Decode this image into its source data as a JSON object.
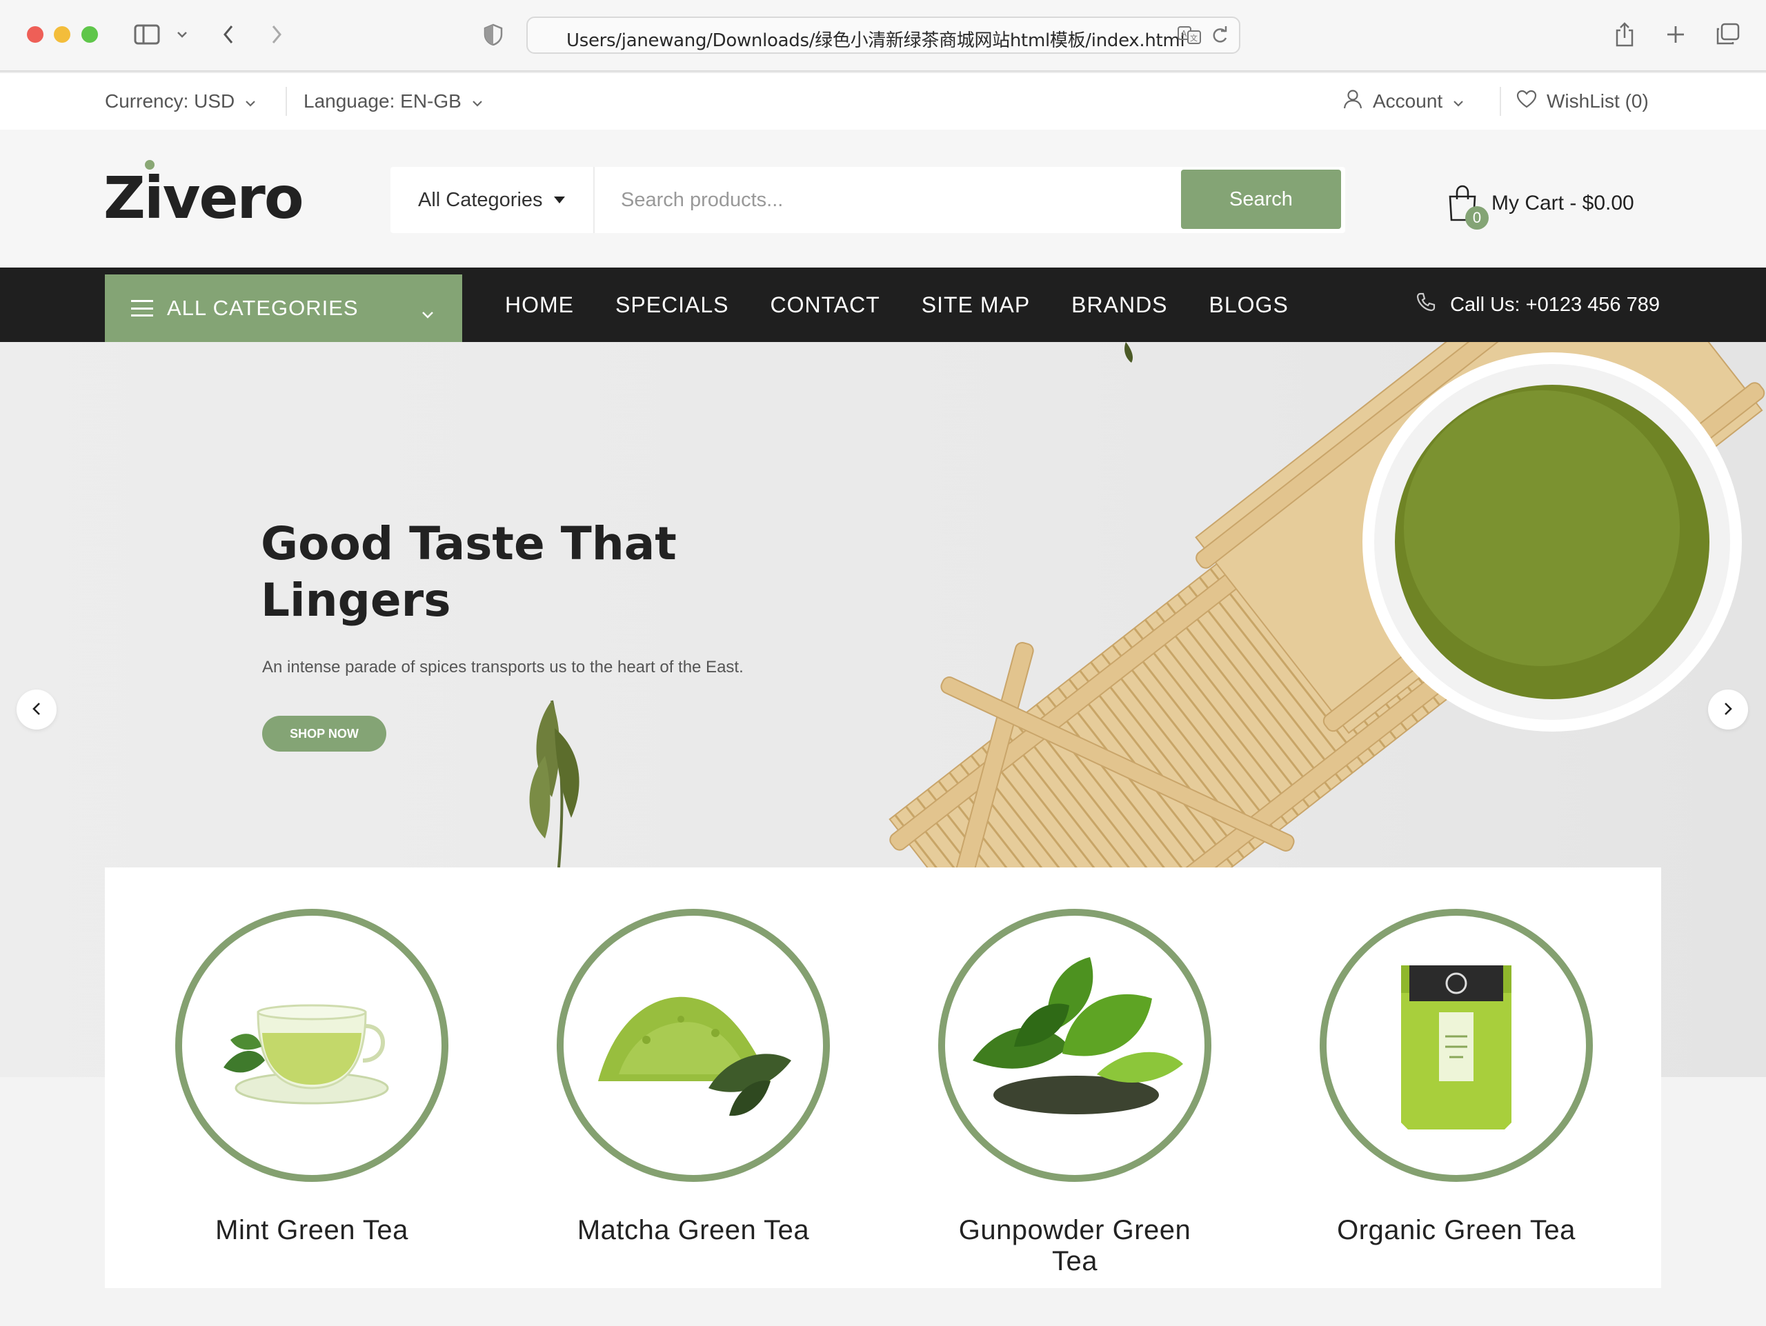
{
  "browser": {
    "url": "Users/janewang/Downloads/绿色小清新绿茶商城网站html模板/index.html"
  },
  "topbar": {
    "currency": "Currency: USD",
    "language": "Language: EN-GB",
    "account": "Account",
    "wishlist": "WishList (0)"
  },
  "header": {
    "logo": "Zivero",
    "category_select": "All Categories",
    "search_placeholder": "Search products...",
    "search_button": "Search",
    "cart_count": "0",
    "cart_label": "My Cart - $0.00"
  },
  "nav": {
    "all_categories": "ALL CATEGORIES",
    "items": [
      "HOME",
      "SPECIALS",
      "CONTACT",
      "SITE MAP",
      "BRANDS",
      "BLOGS"
    ],
    "call": "Call Us: +0123 456 789"
  },
  "hero": {
    "title": "Good Taste That Lingers",
    "subtitle": "An intense parade of spices transports us to the heart of the East.",
    "button": "SHOP NOW"
  },
  "categories": [
    {
      "name": "Mint Green Tea"
    },
    {
      "name": "Matcha Green Tea"
    },
    {
      "name": "Gunpowder Green Tea"
    },
    {
      "name": "Organic Green Tea"
    }
  ],
  "colors": {
    "accent": "#84a475",
    "nav_bg": "#1f1f1f"
  }
}
